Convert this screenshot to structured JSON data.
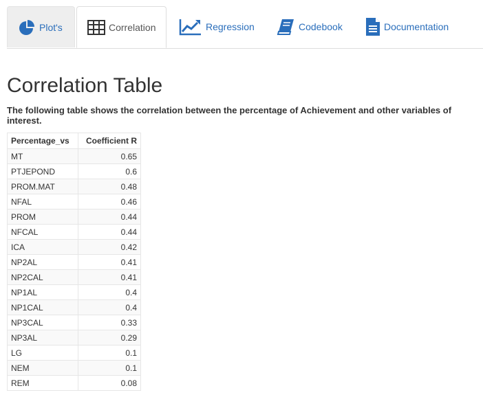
{
  "tabs": [
    {
      "label": "Plot's",
      "icon": "pie-chart-icon"
    },
    {
      "label": "Correlation",
      "icon": "table-icon"
    },
    {
      "label": "Regression",
      "icon": "line-chart-icon"
    },
    {
      "label": "Codebook",
      "icon": "book-icon"
    },
    {
      "label": "Documentation",
      "icon": "document-icon"
    }
  ],
  "active_tab": "Correlation",
  "colors": {
    "link": "#2a6ebb",
    "active_tab_text": "#555555"
  },
  "page": {
    "title": "Correlation Table",
    "intro": "The following table shows the correlation between the percentage of Achievement and other variables of interest."
  },
  "table": {
    "headers": [
      "Percentage_vs",
      "Coefficient R"
    ],
    "rows": [
      [
        "MT",
        "0.65"
      ],
      [
        "PTJEPOND",
        "0.6"
      ],
      [
        "PROM.MAT",
        "0.48"
      ],
      [
        "NFAL",
        "0.46"
      ],
      [
        "PROM",
        "0.44"
      ],
      [
        "NFCAL",
        "0.44"
      ],
      [
        "ICA",
        "0.42"
      ],
      [
        "NP2AL",
        "0.41"
      ],
      [
        "NP2CAL",
        "0.41"
      ],
      [
        "NP1AL",
        "0.4"
      ],
      [
        "NP1CAL",
        "0.4"
      ],
      [
        "NP3CAL",
        "0.33"
      ],
      [
        "NP3AL",
        "0.29"
      ],
      [
        "LG",
        "0.1"
      ],
      [
        "NEM",
        "0.1"
      ],
      [
        "REM",
        "0.08"
      ]
    ]
  }
}
